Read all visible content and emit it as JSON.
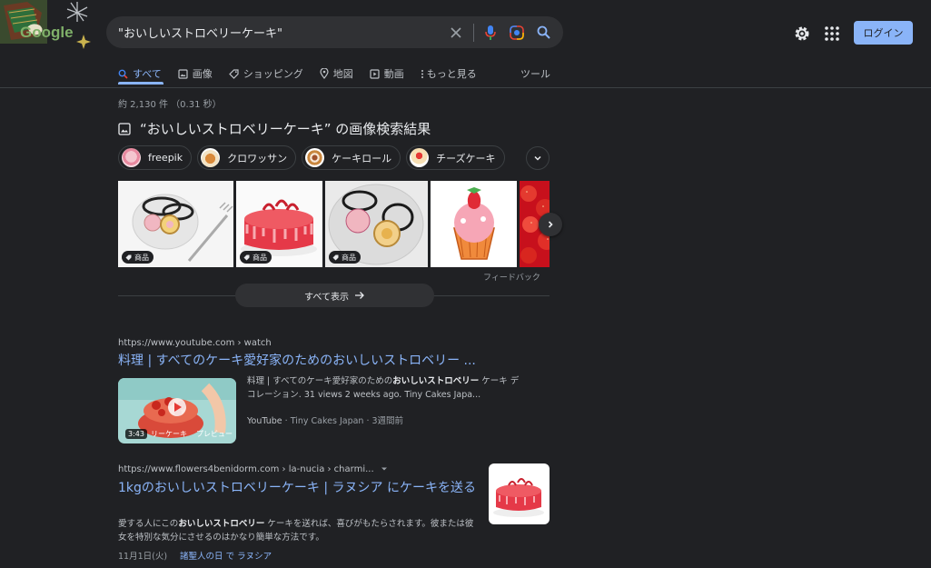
{
  "search": {
    "query": "\"おいしいストロベリーケーキ\""
  },
  "header": {
    "logo_text": "Google",
    "login_label": "ログイン"
  },
  "tabs": [
    {
      "label": "すべて",
      "icon": "search-icon"
    },
    {
      "label": "画像",
      "icon": "image-icon"
    },
    {
      "label": "ショッピング",
      "icon": "tag-icon"
    },
    {
      "label": "地図",
      "icon": "map-pin-icon"
    },
    {
      "label": "動画",
      "icon": "video-icon"
    },
    {
      "label": "もっと見る",
      "icon": "more-vert-icon"
    }
  ],
  "tools_label": "ツール",
  "stats": "約 2,130 件 （0.31 秒）",
  "image_results": {
    "title": "“おいしいストロベリーケーキ” の画像検索結果",
    "chips": [
      "freepik",
      "クロワッサン",
      "ケーキロール",
      "チーズケーキ"
    ],
    "badge_label": "商品",
    "feedback": "フィードバック",
    "show_all": "すべて表示"
  },
  "results": [
    {
      "cite": "https://www.youtube.com › watch",
      "title": "料理 | すべてのケーキ愛好家のためのおいしいストロベリー ...",
      "snippet_pre": "料理 | すべてのケーキ愛好家のための",
      "snippet_bold": "おいしいストロベリー",
      "snippet_post": " ケーキ デコレーション. 31 views 2 weeks ago. Tiny Cakes Japa...",
      "duration": "3:43",
      "preview_label": "プレビュー",
      "thumb_caption": "リーケーキ",
      "source": "YouTube",
      "channel": "Tiny Cakes Japan",
      "age": "3週間前"
    },
    {
      "cite": "https://www.flowers4benidorm.com › la-nucia › charmi...",
      "title": "1kgのおいしいストロベリーケーキ | ラヌシア にケーキを送る",
      "snippet_pre": "愛する人にこの",
      "snippet_bold": "おいしいストロベリー",
      "snippet_post": " ケーキを送れば、喜びがもたらされます。彼または彼女を特別な気分にさせるのはかなり簡単な方法です。",
      "date": "11月1日(火)",
      "link": "諸聖人の日 で ラヌシア"
    }
  ],
  "colors": {
    "accent": "#8ab4f8",
    "background": "#202124",
    "surface": "#303134"
  }
}
